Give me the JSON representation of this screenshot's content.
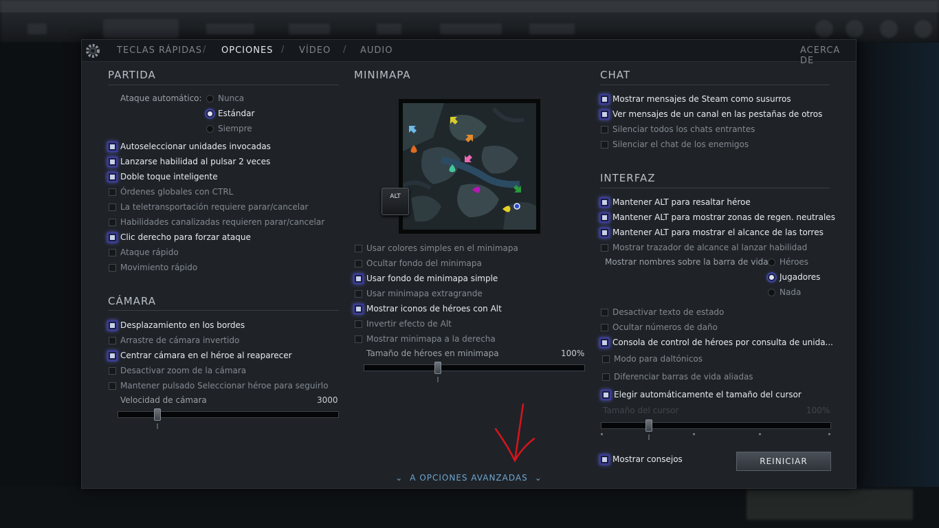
{
  "tabs": [
    {
      "label": "TECLAS RÁPIDAS"
    },
    {
      "label": "OPCIONES"
    },
    {
      "label": "VÍDEO"
    },
    {
      "label": "AUDIO"
    }
  ],
  "tab_separator": "/",
  "about_label": "ACERCA DE",
  "partida": {
    "title": "PARTIDA",
    "auto_attack_label": "Ataque automático:",
    "radios": [
      {
        "label": "Nunca",
        "selected": false
      },
      {
        "label": "Estándar",
        "selected": true
      },
      {
        "label": "Siempre",
        "selected": false
      }
    ],
    "options": [
      {
        "label": "Autoseleccionar unidades invocadas",
        "checked": true
      },
      {
        "label": "Lanzarse habilidad al pulsar 2 veces",
        "checked": true
      },
      {
        "label": "Doble toque inteligente",
        "checked": true
      },
      {
        "label": "Órdenes globales con CTRL",
        "checked": false
      },
      {
        "label": "La teletransportación requiere parar/cancelar",
        "checked": false
      },
      {
        "label": "Habilidades canalizadas requieren parar/cancelar",
        "checked": false
      },
      {
        "label": "Clic derecho para forzar ataque",
        "checked": true
      },
      {
        "label": "Ataque rápido",
        "checked": false
      },
      {
        "label": "Movimiento rápido",
        "checked": false
      }
    ]
  },
  "camara": {
    "title": "CÁMARA",
    "options": [
      {
        "label": "Desplazamiento en los bordes",
        "checked": true
      },
      {
        "label": "Arrastre de cámara invertido",
        "checked": false
      },
      {
        "label": "Centrar cámara en el héroe al reaparecer",
        "checked": true
      },
      {
        "label": "Desactivar zoom de la cámara",
        "checked": false
      },
      {
        "label": "Mantener pulsado Seleccionar héroe para seguirlo",
        "checked": false
      }
    ],
    "speed_label": "Velocidad de cámara",
    "speed_value": "3000",
    "speed_fraction": 0.17
  },
  "minimapa": {
    "title": "MINIMAPA",
    "alt_key": "ALT",
    "options": [
      {
        "label": "Usar colores simples en el minimapa",
        "checked": false
      },
      {
        "label": "Ocultar fondo del minimapa",
        "checked": false
      },
      {
        "label": "Usar fondo de minimapa simple",
        "checked": true
      },
      {
        "label": "Usar minimapa extragrande",
        "checked": false
      },
      {
        "label": "Mostrar iconos de héroes con Alt",
        "checked": true
      },
      {
        "label": "Invertir efecto de Alt",
        "checked": false
      },
      {
        "label": "Mostrar minimapa a la derecha",
        "checked": false
      }
    ],
    "hero_size_label": "Tamaño de héroes en minimapa",
    "hero_size_value": "100%",
    "hero_size_fraction": 0.33
  },
  "chat": {
    "title": "CHAT",
    "options": [
      {
        "label": "Mostrar mensajes de Steam como susurros",
        "checked": true
      },
      {
        "label": "Ver mensajes de un canal en las pestañas de otros",
        "checked": true
      },
      {
        "label": "Silenciar todos los chats entrantes",
        "checked": false
      },
      {
        "label": "Silenciar el chat de los enemigos",
        "checked": false
      }
    ]
  },
  "interfaz": {
    "title": "INTERFAZ",
    "options_top": [
      {
        "label": "Mantener ALT para resaltar héroe",
        "checked": true
      },
      {
        "label": "Mantener ALT para mostrar zonas de regen. neutrales",
        "checked": true
      },
      {
        "label": "Mantener ALT para mostrar el alcance de las torres",
        "checked": true
      },
      {
        "label": "Mostrar trazador de alcance al lanzar habilidad",
        "checked": false
      }
    ],
    "names_label": "Mostrar nombres sobre la barra de vida",
    "names_radios": [
      {
        "label": "Héroes",
        "selected": false
      },
      {
        "label": "Jugadores",
        "selected": true
      },
      {
        "label": "Nada",
        "selected": false
      }
    ],
    "options_bottom": [
      {
        "label": "Desactivar texto de estado",
        "checked": false
      },
      {
        "label": "Ocultar números de daño",
        "checked": false
      },
      {
        "label": "Consola de control de héroes por consulta de unida...",
        "checked": true
      },
      {
        "label": "Modo para daltónicos",
        "checked": false
      },
      {
        "label": "Diferenciar barras de vida aliadas",
        "checked": false
      },
      {
        "label": "Elegir automáticamente el tamaño del cursor",
        "checked": true
      }
    ],
    "cursor_size_label": "Tamaño del cursor",
    "cursor_size_value": "100%",
    "cursor_size_fraction": 0.2,
    "tips_label": "Mostrar consejos",
    "tips_checked": true,
    "reset_label": "REINICIAR"
  },
  "advanced_label": "A OPCIONES AVANZADAS",
  "colors": {
    "accent_blue": "#6fa4cf",
    "annotation_red": "#d8141c",
    "panel_bg": "#1f2328"
  }
}
